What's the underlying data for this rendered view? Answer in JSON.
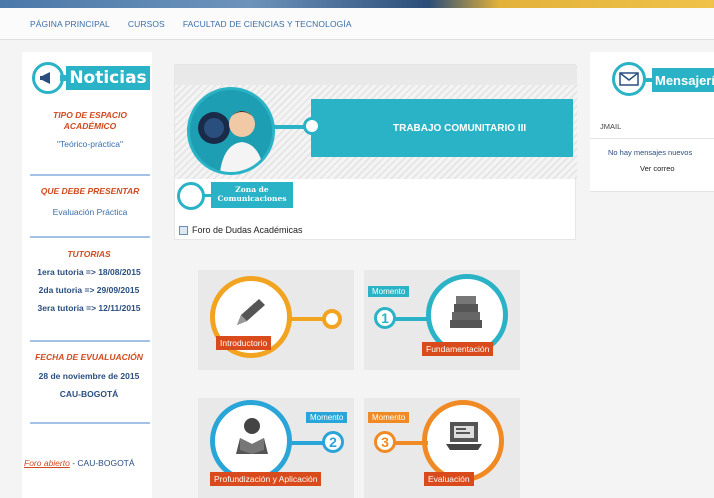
{
  "nav": {
    "items": [
      "PÁGINA PRINCIPAL",
      "CURSOS",
      "FACULTAD DE CIENCIAS Y TECNOLOGÍA"
    ]
  },
  "left": {
    "banner_title": "Noticias",
    "tipo_title": "TIPO DE ESPACIO ACADÉMICO",
    "tipo_value": "\"Teórico-práctica\"",
    "presentar_title": "QUE DEBE PRESENTAR",
    "presentar_value": "Evaluación Práctica",
    "tutorias_title": "TUTORIAS",
    "tutorias": [
      "1era tutoria => 18/08/2015",
      "2da tutoria => 29/09/2015",
      "3era tutoria => 12/11/2015"
    ],
    "fecha_title": "FECHA DE EVUALUACIÓN",
    "fecha_value": "28 de noviembre de 2015",
    "lugar": "CAU-BOGOTÁ",
    "foro_link": "Foro abierto",
    "foro_rest": " - CAU-BOGOTÁ"
  },
  "course": {
    "title": "TRABAJO COMUNITARIO III",
    "zona_title": "Zona de Comunicaciones",
    "foro": "Foro de Dudas Académicas"
  },
  "modules": [
    {
      "label": "Introductorio",
      "color": "#f2a320",
      "momento": "",
      "number": ""
    },
    {
      "label": "Fundamentación",
      "color": "#2ab3c6",
      "momento": "Momento",
      "number": "1"
    },
    {
      "label": "Profundización y Aplicación",
      "color": "#2aa5d8",
      "momento": "Momento",
      "number": "2"
    },
    {
      "label": "Evaluación",
      "color": "#f08a24",
      "momento": "Momento",
      "number": "3"
    }
  ],
  "modules_accent": "#d94b1c",
  "right": {
    "banner_title": "Mensajería",
    "gmail": "JMAIL",
    "no_messages": "No hay mensajes nuevos",
    "ver_correo": "Ver correo"
  },
  "colors": {
    "accent": "#2ab3c6",
    "section_title": "#d14a1f",
    "link_blue": "#3a6ea8"
  }
}
